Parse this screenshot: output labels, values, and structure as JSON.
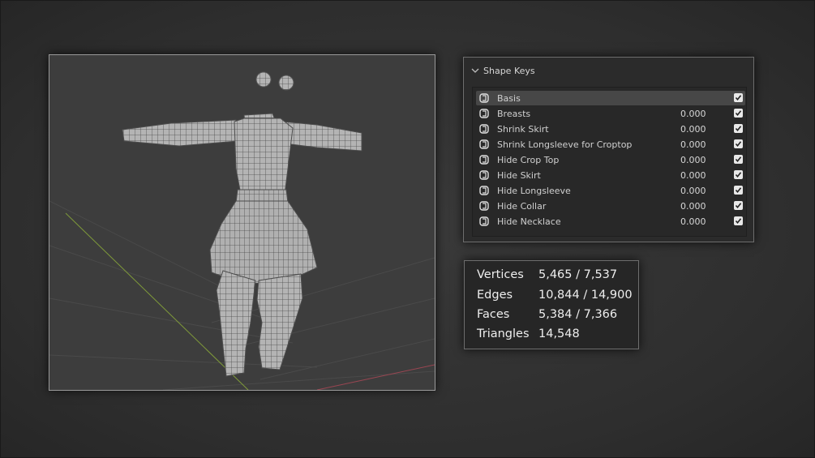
{
  "viewport": {
    "background": "#3d3d3d",
    "wire_color": "#6a6a6a",
    "mesh_color": "#b9b9b9",
    "axis_x_color": "#9a4652",
    "axis_y_color": "#7f9a3a"
  },
  "shape_keys": {
    "panel_title": "Shape Keys",
    "items": [
      {
        "name": "Basis",
        "value": "",
        "checked": true,
        "active": true
      },
      {
        "name": "Breasts",
        "value": "0.000",
        "checked": true,
        "active": false
      },
      {
        "name": "Shrink Skirt",
        "value": "0.000",
        "checked": true,
        "active": false
      },
      {
        "name": "Shrink Longsleeve for Croptop",
        "value": "0.000",
        "checked": true,
        "active": false
      },
      {
        "name": "Hide Crop Top",
        "value": "0.000",
        "checked": true,
        "active": false
      },
      {
        "name": "Hide Skirt",
        "value": "0.000",
        "checked": true,
        "active": false
      },
      {
        "name": "Hide Longsleeve",
        "value": "0.000",
        "checked": true,
        "active": false
      },
      {
        "name": "Hide Collar",
        "value": "0.000",
        "checked": true,
        "active": false
      },
      {
        "name": "Hide Necklace",
        "value": "0.000",
        "checked": true,
        "active": false
      }
    ]
  },
  "statistics": {
    "rows": [
      {
        "label": "Vertices",
        "value": "5,465 / 7,537"
      },
      {
        "label": "Edges",
        "value": "10,844 / 14,900"
      },
      {
        "label": "Faces",
        "value": "5,384 / 7,366"
      },
      {
        "label": "Triangles",
        "value": "14,548"
      }
    ]
  }
}
